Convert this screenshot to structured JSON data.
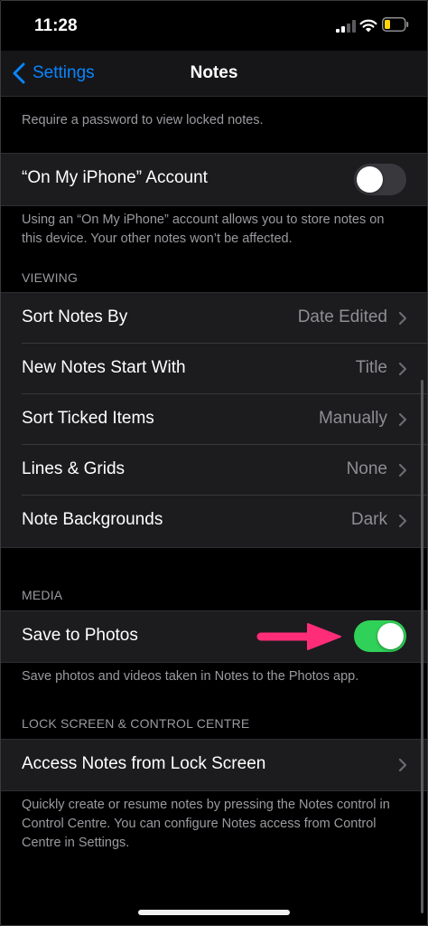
{
  "status": {
    "time": "11:28"
  },
  "nav": {
    "back_label": "Settings",
    "title": "Notes"
  },
  "password": {
    "footnote": "Require a password to view locked notes."
  },
  "account": {
    "label": "“On My iPhone” Account",
    "toggle_on": false,
    "footnote": "Using an “On My iPhone” account allows you to store notes on this device. Your other notes won’t be affected."
  },
  "viewing": {
    "header": "VIEWING",
    "rows": [
      {
        "label": "Sort Notes By",
        "value": "Date Edited"
      },
      {
        "label": "New Notes Start With",
        "value": "Title"
      },
      {
        "label": "Sort Ticked Items",
        "value": "Manually"
      },
      {
        "label": "Lines & Grids",
        "value": "None"
      },
      {
        "label": "Note Backgrounds",
        "value": "Dark"
      }
    ]
  },
  "media": {
    "header": "MEDIA",
    "save_label": "Save to Photos",
    "save_on": true,
    "footnote": "Save photos and videos taken in Notes to the Photos app."
  },
  "lock": {
    "header": "LOCK SCREEN & CONTROL CENTRE",
    "row_label": "Access Notes from Lock Screen",
    "footnote": "Quickly create or resume notes by pressing the Notes control in Control Centre. You can configure Notes access from Control Centre in Settings."
  },
  "colors": {
    "accent": "#0a84ff",
    "toggle_on": "#30d158",
    "toggle_off": "#39393d",
    "annotation_arrow": "#ff2d78",
    "battery_low": "#ffd60a"
  },
  "icons": {
    "back": "chevron-left-icon",
    "row_chevron": "chevron-right-icon",
    "signal": "cellular-signal-icon",
    "wifi": "wifi-icon",
    "battery": "battery-icon"
  }
}
